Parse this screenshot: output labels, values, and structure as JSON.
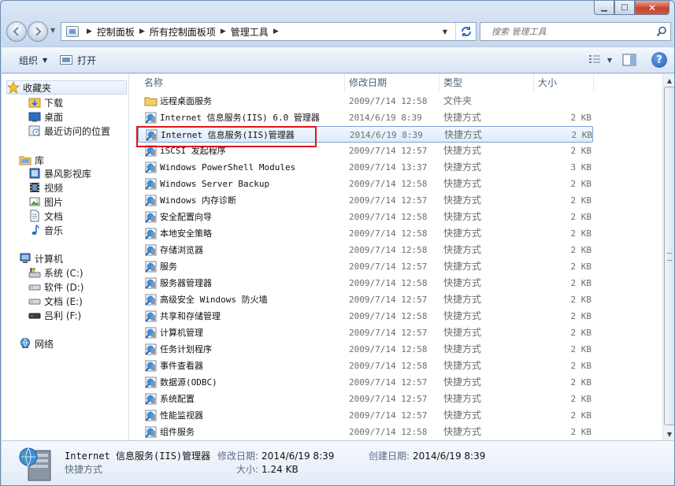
{
  "window": {
    "minimize": "▁",
    "maximize": "□",
    "close": "✕"
  },
  "address": {
    "crumbs": [
      "控制面板",
      "所有控制面板项",
      "管理工具"
    ],
    "search_placeholder": "搜索 管理工具"
  },
  "toolbar": {
    "organize": "组织",
    "open": "打开"
  },
  "nav": {
    "favorites": "收藏夹",
    "downloads": "下载",
    "desktop": "桌面",
    "recent": "最近访问的位置",
    "libraries": "库",
    "videos_lib": "暴风影视库",
    "video": "视频",
    "pictures": "图片",
    "documents": "文档",
    "music": "音乐",
    "computer": "计算机",
    "drive_c": "系统 (C:)",
    "drive_d": "软件 (D:)",
    "drive_e": "文档 (E:)",
    "drive_f": "吕利 (F:)",
    "network": "网络"
  },
  "columns": {
    "name": "名称",
    "date": "修改日期",
    "type": "类型",
    "size": "大小"
  },
  "files": [
    {
      "name": "远程桌面服务",
      "date": "2009/7/14 12:58",
      "type": "文件夹",
      "size": ""
    },
    {
      "name": "Internet 信息服务(IIS) 6.0 管理器",
      "date": "2014/6/19 8:39",
      "type": "快捷方式",
      "size": "2 KB"
    },
    {
      "name": "Internet 信息服务(IIS)管理器",
      "date": "2014/6/19 8:39",
      "type": "快捷方式",
      "size": "2 KB"
    },
    {
      "name": "iSCSI 发起程序",
      "date": "2009/7/14 12:57",
      "type": "快捷方式",
      "size": "2 KB"
    },
    {
      "name": "Windows PowerShell Modules",
      "date": "2009/7/14 13:37",
      "type": "快捷方式",
      "size": "3 KB"
    },
    {
      "name": "Windows Server Backup",
      "date": "2009/7/14 12:58",
      "type": "快捷方式",
      "size": "2 KB"
    },
    {
      "name": "Windows 内存诊断",
      "date": "2009/7/14 12:57",
      "type": "快捷方式",
      "size": "2 KB"
    },
    {
      "name": "安全配置向导",
      "date": "2009/7/14 12:58",
      "type": "快捷方式",
      "size": "2 KB"
    },
    {
      "name": "本地安全策略",
      "date": "2009/7/14 12:58",
      "type": "快捷方式",
      "size": "2 KB"
    },
    {
      "name": "存储浏览器",
      "date": "2009/7/14 12:58",
      "type": "快捷方式",
      "size": "2 KB"
    },
    {
      "name": "服务",
      "date": "2009/7/14 12:57",
      "type": "快捷方式",
      "size": "2 KB"
    },
    {
      "name": "服务器管理器",
      "date": "2009/7/14 12:58",
      "type": "快捷方式",
      "size": "2 KB"
    },
    {
      "name": "高级安全 Windows 防火墙",
      "date": "2009/7/14 12:57",
      "type": "快捷方式",
      "size": "2 KB"
    },
    {
      "name": "共享和存储管理",
      "date": "2009/7/14 12:58",
      "type": "快捷方式",
      "size": "2 KB"
    },
    {
      "name": "计算机管理",
      "date": "2009/7/14 12:57",
      "type": "快捷方式",
      "size": "2 KB"
    },
    {
      "name": "任务计划程序",
      "date": "2009/7/14 12:58",
      "type": "快捷方式",
      "size": "2 KB"
    },
    {
      "name": "事件查看器",
      "date": "2009/7/14 12:58",
      "type": "快捷方式",
      "size": "2 KB"
    },
    {
      "name": "数据源(ODBC)",
      "date": "2009/7/14 12:57",
      "type": "快捷方式",
      "size": "2 KB"
    },
    {
      "name": "系统配置",
      "date": "2009/7/14 12:57",
      "type": "快捷方式",
      "size": "2 KB"
    },
    {
      "name": "性能监视器",
      "date": "2009/7/14 12:57",
      "type": "快捷方式",
      "size": "2 KB"
    },
    {
      "name": "组件服务",
      "date": "2009/7/14 12:58",
      "type": "快捷方式",
      "size": "2 KB"
    }
  ],
  "selected_index": 2,
  "details": {
    "name": "Internet 信息服务(IIS)管理器",
    "type": "快捷方式",
    "modified_label": "修改日期:",
    "modified_value": "2014/6/19 8:39",
    "created_label": "创建日期:",
    "created_value": "2014/6/19 8:39",
    "size_label": "大小:",
    "size_value": "1.24 KB"
  },
  "colors": {
    "highlight_border": "#e0141e",
    "selection_fill": "#dcebfc"
  }
}
